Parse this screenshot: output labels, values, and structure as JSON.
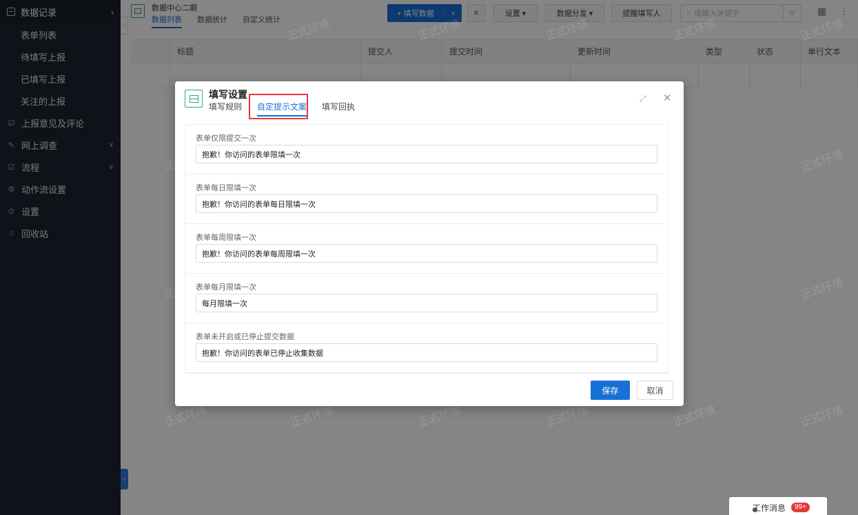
{
  "sidebar": {
    "header_label": "数据记录",
    "sub_items": [
      "表单列表",
      "待填写上报",
      "已填写上报",
      "关注的上报"
    ],
    "items": [
      {
        "label": "上报意见及评论",
        "icon": "comment-icon",
        "glyph": "☑",
        "chevron": ""
      },
      {
        "label": "网上调查",
        "icon": "survey-icon",
        "glyph": "✎",
        "chevron": "∨"
      },
      {
        "label": "流程",
        "icon": "flow-icon",
        "glyph": "☑",
        "chevron": "∨"
      },
      {
        "label": "动作流设置",
        "icon": "gear-icon",
        "glyph": "⚙",
        "chevron": ""
      },
      {
        "label": "设置",
        "icon": "settings-icon",
        "glyph": "⊙",
        "chevron": ""
      },
      {
        "label": "回收站",
        "icon": "trash-icon",
        "glyph": "⌂",
        "chevron": ""
      }
    ]
  },
  "topbar": {
    "app_title": "数据中心二期",
    "tabs": [
      "数据列表",
      "数据统计",
      "自定义统计"
    ],
    "fill_button": "+ 填写数据",
    "settings_button": "设置 ▾",
    "distribute_button": "数据分发 ▾",
    "remind_button": "提醒填写人",
    "search_placeholder": "请输入关键字"
  },
  "table": {
    "headers": [
      "标题",
      "提交人",
      "提交时间",
      "更新时间",
      "类型",
      "状态",
      "单行文本"
    ]
  },
  "watermark_text": "正式环境",
  "modal": {
    "title": "填写设置",
    "tabs": [
      "填写规则",
      "自定提示文案",
      "填写回执"
    ],
    "active_tab": "自定提示文案",
    "sections": [
      {
        "label": "表单仅限提交一次",
        "value": "抱歉！你访问的表单限填一次"
      },
      {
        "label": "表单每日限填一次",
        "value": "抱歉！你访问的表单每日限填一次"
      },
      {
        "label": "表单每周限填一次",
        "value": "抱歉！你访问的表单每周限填一次"
      },
      {
        "label": "表单每月限填一次",
        "value": "每月限填一次"
      },
      {
        "label": "表单未开启或已停止提交数据",
        "value": "抱歉！你访问的表单已停止收集数据"
      }
    ],
    "save_button": "保存",
    "cancel_button": "取消"
  },
  "message_bar": {
    "label": "工作消息",
    "badge": "99+"
  },
  "colors": {
    "primary": "#1770d6",
    "sidebar_bg": "#1f2430",
    "highlight_border": "#e53935",
    "app_icon_green": "#2faa75"
  }
}
